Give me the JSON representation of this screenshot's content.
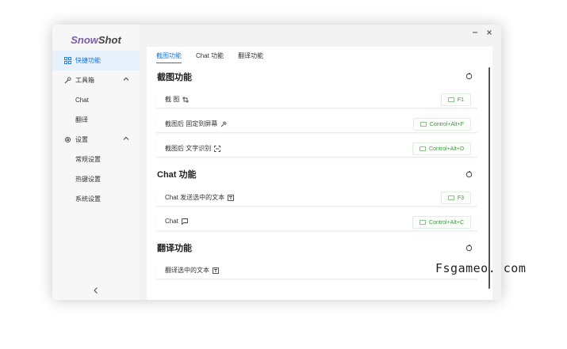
{
  "app": {
    "logo_part1": "Snow",
    "logo_part2": "Shot"
  },
  "window_controls": {
    "minimize_icon": "minus-icon",
    "close_icon": "close-icon"
  },
  "sidebar": {
    "items": [
      {
        "label": "快捷功能",
        "icon": "shortcut-icon",
        "active": true
      },
      {
        "label": "工具箱",
        "icon": "tool-icon",
        "expanded": true
      },
      {
        "label": "Chat"
      },
      {
        "label": "翻译"
      },
      {
        "label": "设置",
        "icon": "gear-icon",
        "expanded": true
      },
      {
        "label": "常规设置"
      },
      {
        "label": "热键设置"
      },
      {
        "label": "系统设置"
      }
    ],
    "collapse_icon": "chevron-left-icon"
  },
  "tabs": [
    {
      "label": "截图功能",
      "active": true
    },
    {
      "label": "Chat 功能"
    },
    {
      "label": "翻译功能"
    }
  ],
  "sections": [
    {
      "title": "截图功能",
      "rows": [
        {
          "label": "截 图",
          "icon": "crop-icon",
          "hotkey": "F1"
        },
        {
          "label": "截图后 固定到屏幕",
          "icon": "pin-icon",
          "hotkey": "Control+Alt+F"
        },
        {
          "label": "截图后 文字识别",
          "icon": "scan-text-icon",
          "hotkey": "Control+Alt+D"
        }
      ]
    },
    {
      "title": "Chat 功能",
      "rows": [
        {
          "label": "Chat 发送选中的文本",
          "icon": "text-select-icon",
          "hotkey": "F3"
        },
        {
          "label": "Chat",
          "icon": "chat-icon",
          "hotkey": "Control+Alt+C"
        }
      ]
    },
    {
      "title": "翻译功能",
      "rows": [
        {
          "label": "翻译选中的文本",
          "icon": "text-select-icon",
          "hotkey": ""
        }
      ]
    }
  ],
  "watermark": "Fsgameo. com",
  "colors": {
    "accent": "#1677d6",
    "hotkey_text": "#3a9a3a",
    "logo_accent": "#7b5aa6"
  }
}
